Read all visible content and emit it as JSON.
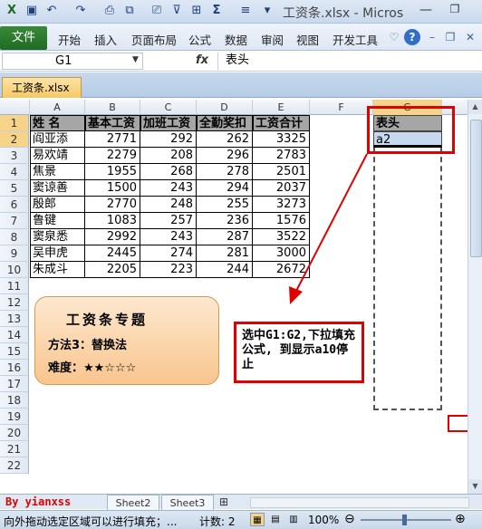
{
  "window": {
    "title": "工资条.xlsx - Micros"
  },
  "ribbon": {
    "file": "文件",
    "tabs": [
      "开始",
      "插入",
      "页面布局",
      "公式",
      "数据",
      "审阅",
      "视图",
      "开发工具"
    ]
  },
  "formula_bar": {
    "name_box": "G1",
    "fx": "fx",
    "content": "表头"
  },
  "document_tab": "工资条.xlsx",
  "columns": [
    "A",
    "B",
    "C",
    "D",
    "E",
    "F",
    "G"
  ],
  "rows": [
    "1",
    "2",
    "3",
    "4",
    "5",
    "6",
    "7",
    "8",
    "9",
    "10",
    "11",
    "12",
    "13",
    "14",
    "15",
    "16",
    "17",
    "18",
    "19",
    "20",
    "21",
    "22"
  ],
  "table": {
    "headers": [
      "姓  名",
      "基本工资",
      "加班工资",
      "全勤奖扣",
      "工资合计"
    ],
    "records": [
      [
        "阎亚添",
        "2771",
        "292",
        "262",
        "3325"
      ],
      [
        "易欢靖",
        "2279",
        "208",
        "296",
        "2783"
      ],
      [
        "焦景",
        "1955",
        "268",
        "278",
        "2501"
      ],
      [
        "窦谅善",
        "1500",
        "243",
        "294",
        "2037"
      ],
      [
        "殷郎",
        "2770",
        "248",
        "255",
        "3273"
      ],
      [
        "鲁键",
        "1083",
        "257",
        "236",
        "1576"
      ],
      [
        "窦泉悉",
        "2992",
        "243",
        "287",
        "3522"
      ],
      [
        "吴申虎",
        "2445",
        "274",
        "281",
        "3000"
      ],
      [
        "朱成斗",
        "2205",
        "223",
        "244",
        "2672"
      ]
    ]
  },
  "g_cells": {
    "g1": "表头",
    "g2": "a2"
  },
  "info_box": {
    "title": "工资条专题",
    "method": "方法3：替换法",
    "difficulty": "难度：★★☆☆☆"
  },
  "callout": {
    "text": "选中G1:G2,下拉填充公式, 到显示a10停止"
  },
  "sheet_tabs": {
    "watermark": "By yianxss",
    "sheet2": "Sheet2",
    "sheet3": "Sheet3"
  },
  "status": {
    "hint": "向外拖动选定区域可以进行填充；...",
    "count": "计数: 2",
    "zoom": "100%"
  },
  "colors": {
    "header_fill": "#a6a6a6",
    "selection": "#f7d38a",
    "callout_border": "#e00000",
    "file_tab": "#2e7d32"
  }
}
